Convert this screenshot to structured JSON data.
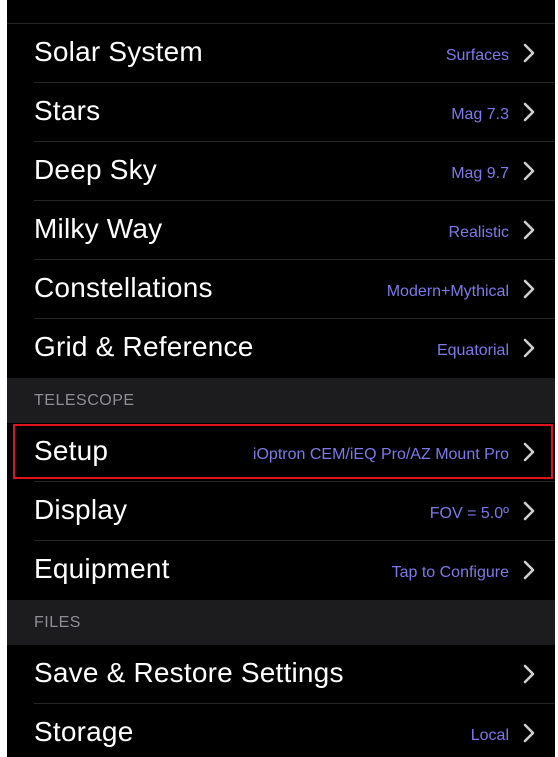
{
  "rows_display": [
    {
      "label": "Solar System",
      "value": "Surfaces"
    },
    {
      "label": "Stars",
      "value": "Mag 7.3"
    },
    {
      "label": "Deep Sky",
      "value": "Mag 9.7"
    },
    {
      "label": "Milky Way",
      "value": "Realistic"
    },
    {
      "label": "Constellations",
      "value": "Modern+Mythical"
    },
    {
      "label": "Grid & Reference",
      "value": "Equatorial"
    }
  ],
  "telescope": {
    "header": "TELESCOPE",
    "rows": [
      {
        "label": "Setup",
        "value": "iOptron CEM/iEQ Pro/AZ Mount Pro"
      },
      {
        "label": "Display",
        "value": "FOV = 5.0º"
      },
      {
        "label": "Equipment",
        "value": "Tap to Configure"
      }
    ]
  },
  "files": {
    "header": "FILES",
    "rows": [
      {
        "label": "Save & Restore Settings",
        "value": ""
      },
      {
        "label": "Storage",
        "value": "Local"
      }
    ]
  },
  "colors": {
    "background": "#000000",
    "label": "#ffffff",
    "value": "#7f79e8",
    "section_bg": "#1c1c1e",
    "section_text": "#8e8e93",
    "highlight": "#e0141e"
  },
  "icons": {
    "disclosure": "chevron-right-icon"
  }
}
